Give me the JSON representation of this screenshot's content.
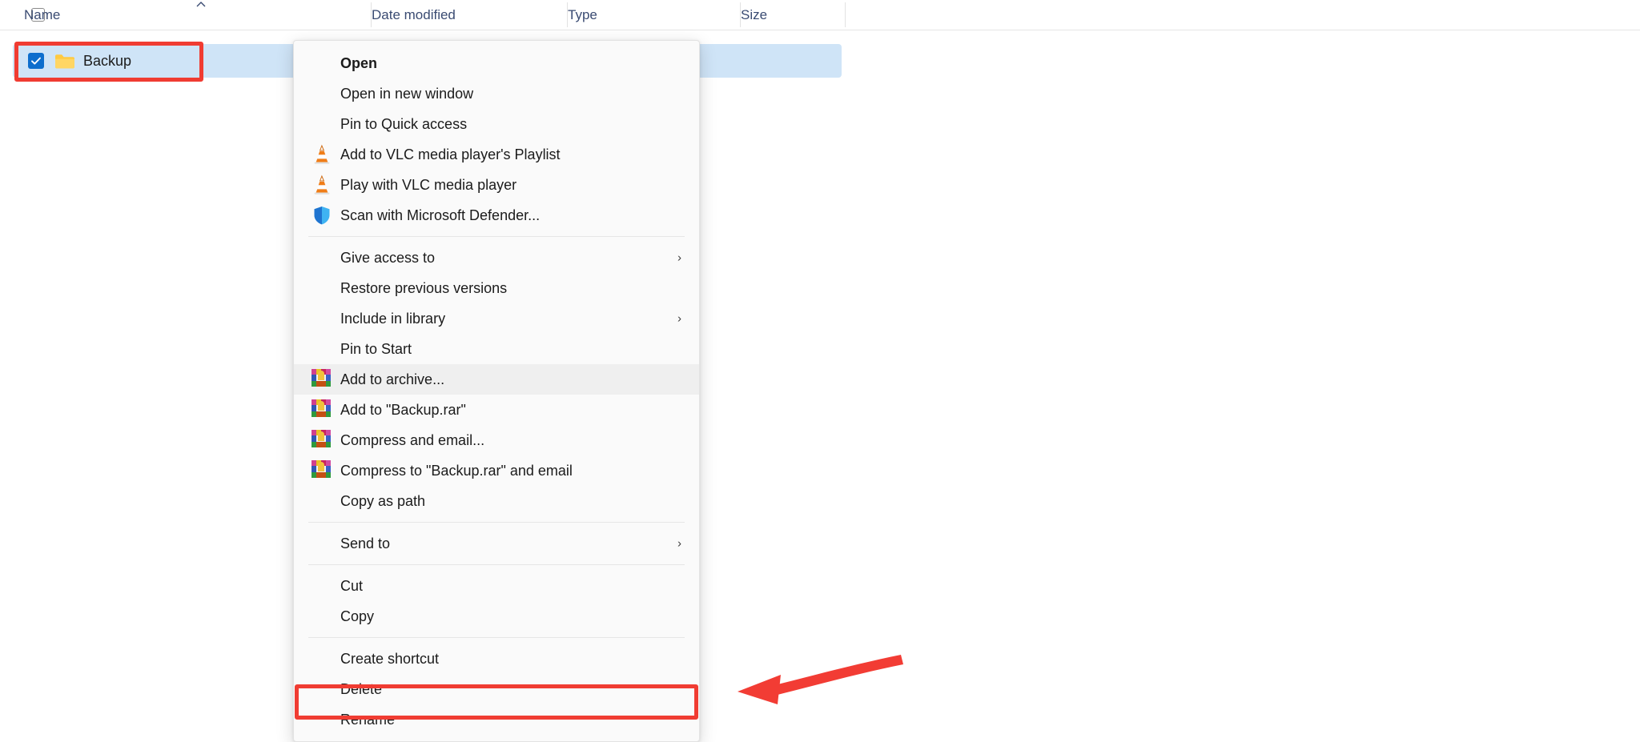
{
  "explorer": {
    "columns": [
      {
        "label": "Name",
        "name": "column-header-name"
      },
      {
        "label": "Date modified",
        "name": "column-header-date-modified"
      },
      {
        "label": "Type",
        "name": "column-header-type"
      },
      {
        "label": "Size",
        "name": "column-header-size"
      }
    ],
    "sort_indicator": "︿",
    "row": {
      "name": "Backup",
      "selected": true,
      "checked": true,
      "icon": "folder-icon"
    }
  },
  "context_menu": {
    "items": [
      {
        "label": "Open",
        "icon": null,
        "bold": true,
        "submenu": false,
        "separator_after": false,
        "hovered": false
      },
      {
        "label": "Open in new window",
        "icon": null,
        "bold": false,
        "submenu": false,
        "separator_after": false,
        "hovered": false
      },
      {
        "label": "Pin to Quick access",
        "icon": null,
        "bold": false,
        "submenu": false,
        "separator_after": false,
        "hovered": false
      },
      {
        "label": "Add to VLC media player's Playlist",
        "icon": "vlc-cone-icon",
        "bold": false,
        "submenu": false,
        "separator_after": false,
        "hovered": false
      },
      {
        "label": "Play with VLC media player",
        "icon": "vlc-cone-icon",
        "bold": false,
        "submenu": false,
        "separator_after": false,
        "hovered": false
      },
      {
        "label": "Scan with Microsoft Defender...",
        "icon": "defender-shield-icon",
        "bold": false,
        "submenu": false,
        "separator_after": true,
        "hovered": false
      },
      {
        "label": "Give access to",
        "icon": null,
        "bold": false,
        "submenu": true,
        "separator_after": false,
        "hovered": false
      },
      {
        "label": "Restore previous versions",
        "icon": null,
        "bold": false,
        "submenu": false,
        "separator_after": false,
        "hovered": false
      },
      {
        "label": "Include in library",
        "icon": null,
        "bold": false,
        "submenu": true,
        "separator_after": false,
        "hovered": false
      },
      {
        "label": "Pin to Start",
        "icon": null,
        "bold": false,
        "submenu": false,
        "separator_after": false,
        "hovered": false
      },
      {
        "label": "Add to archive...",
        "icon": "winrar-icon",
        "bold": false,
        "submenu": false,
        "separator_after": false,
        "hovered": true
      },
      {
        "label": "Add to \"Backup.rar\"",
        "icon": "winrar-icon",
        "bold": false,
        "submenu": false,
        "separator_after": false,
        "hovered": false
      },
      {
        "label": "Compress and email...",
        "icon": "winrar-icon",
        "bold": false,
        "submenu": false,
        "separator_after": false,
        "hovered": false
      },
      {
        "label": "Compress to \"Backup.rar\" and email",
        "icon": "winrar-icon",
        "bold": false,
        "submenu": false,
        "separator_after": false,
        "hovered": false
      },
      {
        "label": "Copy as path",
        "icon": null,
        "bold": false,
        "submenu": false,
        "separator_after": true,
        "hovered": false
      },
      {
        "label": "Send to",
        "icon": null,
        "bold": false,
        "submenu": true,
        "separator_after": true,
        "hovered": false
      },
      {
        "label": "Cut",
        "icon": null,
        "bold": false,
        "submenu": false,
        "separator_after": false,
        "hovered": false
      },
      {
        "label": "Copy",
        "icon": null,
        "bold": false,
        "submenu": false,
        "separator_after": true,
        "hovered": false
      },
      {
        "label": "Create shortcut",
        "icon": null,
        "bold": false,
        "submenu": false,
        "separator_after": false,
        "hovered": false
      },
      {
        "label": "Delete",
        "icon": null,
        "bold": false,
        "submenu": false,
        "separator_after": false,
        "hovered": false
      },
      {
        "label": "Rename",
        "icon": null,
        "bold": false,
        "submenu": false,
        "separator_after": false,
        "hovered": false
      }
    ],
    "submenu_chevron": "›"
  },
  "annotations": {
    "row_highlight": {
      "target": "Backup",
      "color": "#f03c32"
    },
    "rename_highlight": {
      "target": "Rename",
      "color": "#f03c32"
    },
    "arrow": {
      "direction": "left",
      "points_to": "Rename",
      "color": "#f03c32"
    }
  },
  "colors": {
    "accent": "#0d6ecd",
    "selection_row": "#cfe4f7",
    "annotation_red": "#f03c32",
    "menu_background": "#fafafa",
    "menu_hover": "#efefef",
    "header_text": "#3a4b72",
    "folder_yellow": "#ffd25a"
  }
}
